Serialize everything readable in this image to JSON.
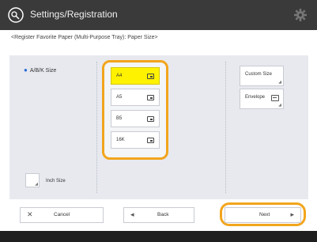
{
  "header": {
    "title": "Settings/Registration",
    "app_icon": "settings-app-icon",
    "gear_icon": "gear-icon"
  },
  "breadcrumb": "<Register Favorite Paper (Multi-Purpose Tray): Paper Size>",
  "left": {
    "abk_label": "A/B/K Size",
    "inch_label": "Inch Size"
  },
  "paper_sizes": [
    {
      "label": "A4",
      "selected": true
    },
    {
      "label": "A5",
      "selected": false
    },
    {
      "label": "B5",
      "selected": false
    },
    {
      "label": "16K",
      "selected": false
    }
  ],
  "side_buttons": {
    "custom_size": "Custom Size",
    "envelope": "Envelope"
  },
  "buttons": {
    "cancel": "Cancel",
    "back": "Back",
    "next": "Next"
  },
  "colors": {
    "highlight": "#f2a51c",
    "selected": "#fff200",
    "header": "#3a3a3a"
  }
}
